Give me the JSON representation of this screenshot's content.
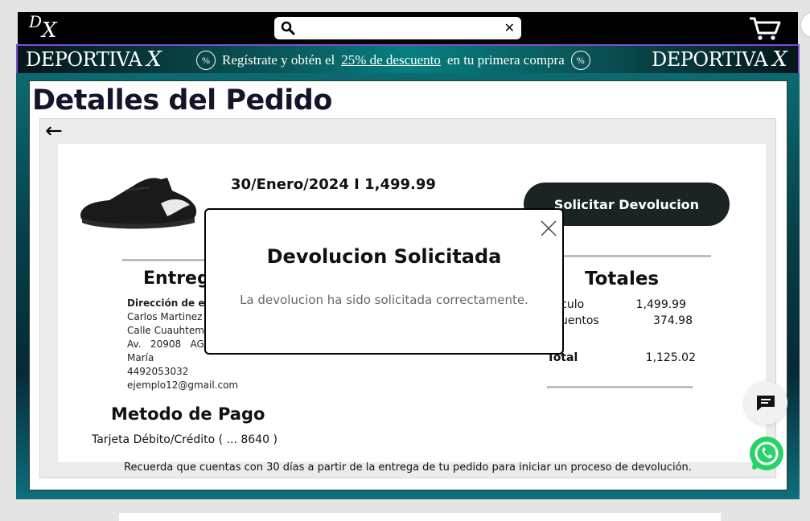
{
  "header": {
    "logo_text": "DX",
    "search": {
      "placeholder": "",
      "value": ""
    },
    "icons": {
      "search": "search-icon",
      "clear": "close-icon",
      "cart": "cart-icon"
    }
  },
  "promo": {
    "brand": "DEPORTIVA",
    "brand_mark": "X",
    "text_before": "Regístrate y obtén el",
    "text_link": "25% de descuento",
    "text_after": "en tu primera compra",
    "percent_icon": "%"
  },
  "page": {
    "title": "Detalles del Pedido",
    "back_icon": "←"
  },
  "order": {
    "date_total": "30/Enero/2024 I 1,499.99",
    "return_button": "Solicitar Devolucion"
  },
  "delivery": {
    "title": "Entrega",
    "address_label": "Dirección de er",
    "name": "Carlos Martinez",
    "street": "Calle Cuauhtemo",
    "city_line": "Av.   20908   AGU",
    "extra": "María",
    "phone": "4492053032",
    "email": "ejemplo12@gmail.com"
  },
  "payment": {
    "title": "Metodo de Pago",
    "method": "Tarjeta Débito/Crédito ( ... 8640 )"
  },
  "totals": {
    "title": "Totales",
    "rows": [
      {
        "label": "rticulo",
        "value": "1,499.99"
      },
      {
        "label": "scuentos",
        "value": "374.98"
      },
      {
        "label": "Total",
        "value": "1,125.02"
      }
    ]
  },
  "note": "Recuerda que cuentas con 30 días a partir de la entrega de tu pedido para iniciar un proceso de devolución.",
  "modal": {
    "title": "Devolucion Solicitada",
    "message": "La devolucion ha sido solicitada correctamente."
  },
  "colors": {
    "header_bg": "#000000",
    "banner_teal": "#077f80",
    "banner_border": "#7c4dd6",
    "button_dark": "#1b2325",
    "whatsapp": "#25d366"
  }
}
